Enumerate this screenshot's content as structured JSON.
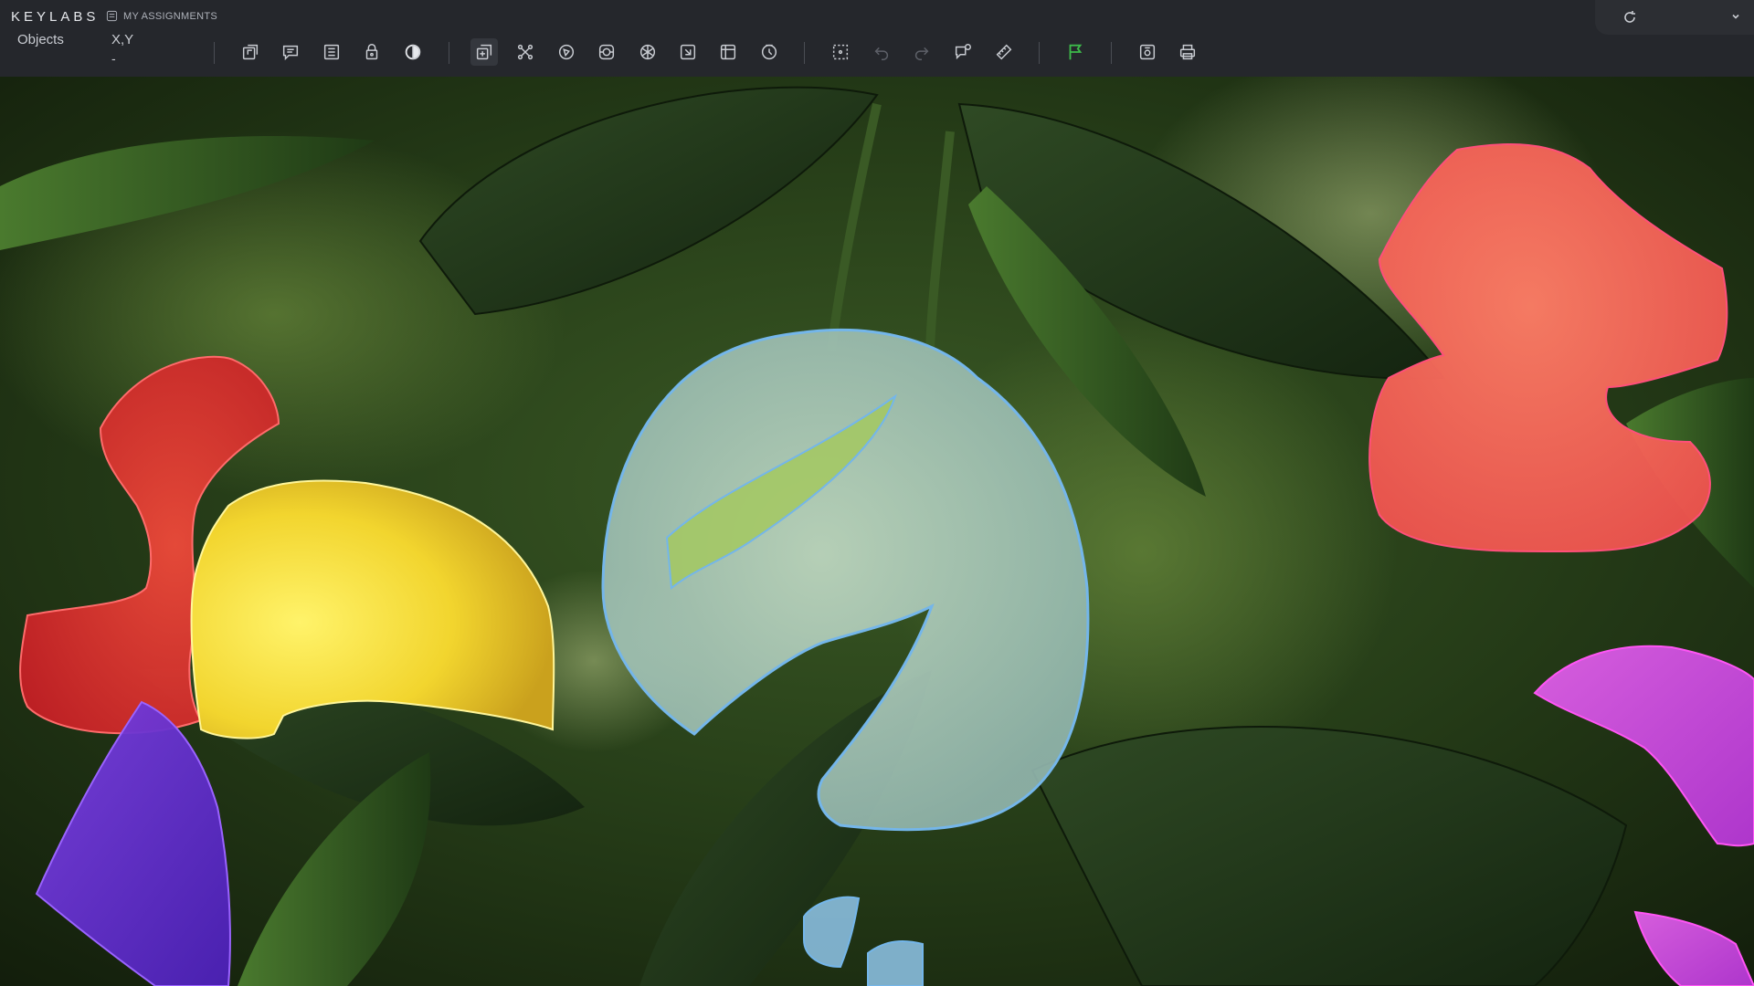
{
  "app": {
    "brand": "KEYLABS",
    "assignments_label": "MY ASSIGNMENTS"
  },
  "panel": {
    "objects_label": "Objects",
    "xy_label": "X,Y",
    "xy_value": "-"
  },
  "toolbar": {
    "tools": [
      "new-object-icon",
      "comment-icon",
      "list-icon",
      "lock-icon",
      "contrast-icon",
      "copy-layers-icon",
      "keypoints-icon",
      "polygon-icon",
      "mask-icon",
      "grid-icon",
      "rect-icon",
      "box-icon",
      "timer-icon",
      "selection-icon",
      "undo-icon",
      "redo-icon",
      "review-icon",
      "ruler-icon",
      "flag-icon",
      "screenshot-icon",
      "print-icon"
    ],
    "flag_color": "#3dbb4a"
  },
  "annotations": [
    {
      "name": "red",
      "color": "#e0302f"
    },
    {
      "name": "yellow",
      "color": "#f2d52e"
    },
    {
      "name": "blue",
      "color": "#8fc6ea"
    },
    {
      "name": "salmon",
      "color": "#ff6b59"
    },
    {
      "name": "magenta",
      "color": "#cc3fe0"
    },
    {
      "name": "indigo",
      "color": "#5f2bd0"
    }
  ]
}
